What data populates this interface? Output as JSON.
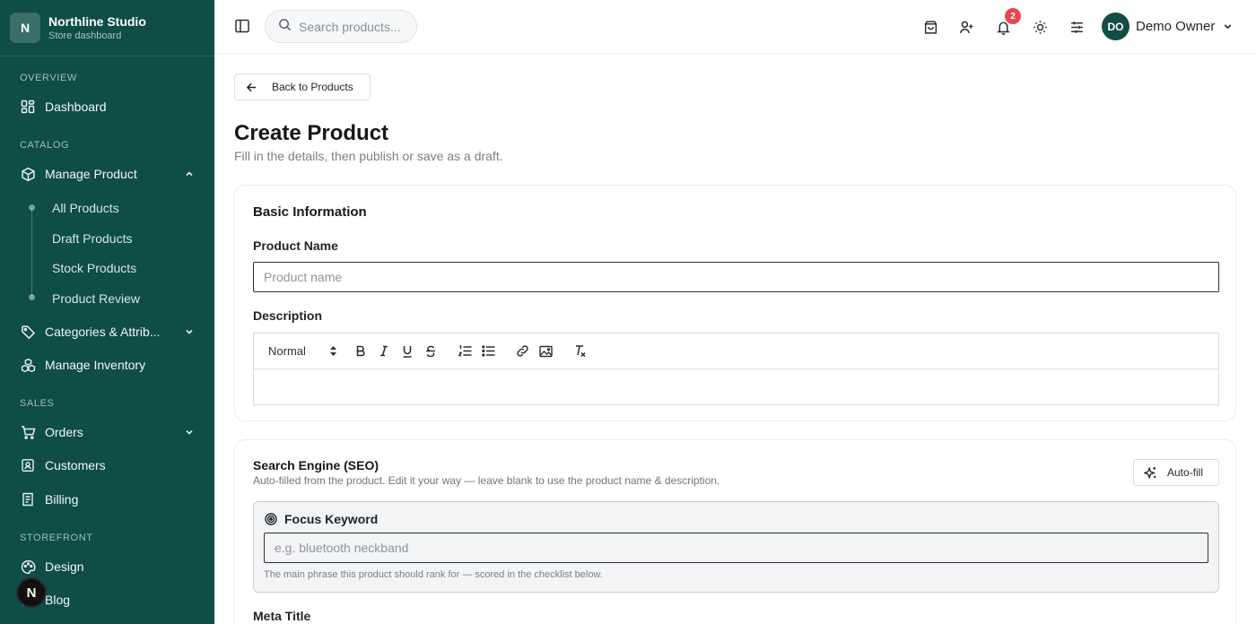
{
  "brand": {
    "initial": "N",
    "name": "Northline Studio",
    "subtitle": "Store dashboard"
  },
  "sidebar": {
    "sections": {
      "overview": "OVERVIEW",
      "catalog": "CATALOG",
      "sales": "SALES",
      "storefront": "STOREFRONT"
    },
    "items": {
      "dashboard": "Dashboard",
      "manage_product": "Manage Product",
      "categories": "Categories & Attrib...",
      "manage_inventory": "Manage Inventory",
      "orders": "Orders",
      "customers": "Customers",
      "billing": "Billing",
      "design": "Design",
      "blog": "Blog"
    },
    "sub_items": [
      "All Products",
      "Draft Products",
      "Stock Products",
      "Product Review"
    ],
    "fab_letter": "N"
  },
  "topbar": {
    "search_placeholder": "Search products...",
    "notification_count": "2",
    "user_initials": "DO",
    "user_name": "Demo Owner"
  },
  "main": {
    "back_label": "Back to Products",
    "title": "Create Product",
    "subtitle": "Fill in the details, then publish or save as a draft.",
    "basic": {
      "title": "Basic Information",
      "name_label": "Product Name",
      "name_placeholder": "Product name",
      "description_label": "Description",
      "format_value": "Normal"
    },
    "seo": {
      "title": "Search Engine (SEO)",
      "subtitle": "Auto-filled from the product. Edit it your way — leave blank to use the product name & description.",
      "autofill_label": "Auto-fill",
      "focus_label": "Focus Keyword",
      "focus_placeholder": "e.g. bluetooth neckband",
      "focus_help": "The main phrase this product should rank for — scored in the checklist below.",
      "meta_title_label": "Meta Title"
    }
  },
  "colors": {
    "sidebar_bg": "#0f4d47",
    "badge": "#e5484d",
    "avatar_bg": "#124d46"
  }
}
